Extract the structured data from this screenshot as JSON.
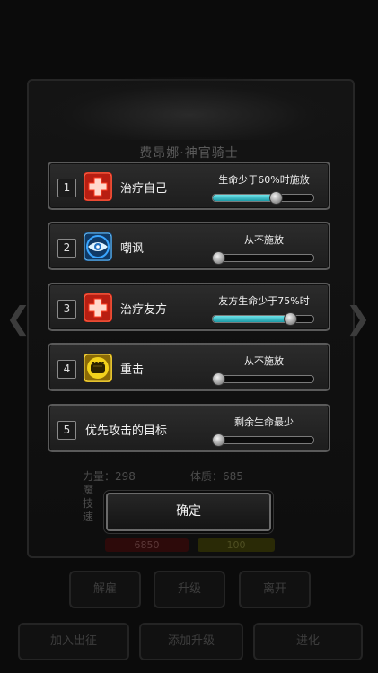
{
  "background": {
    "title": "费昂娜·神官骑士",
    "stats": [
      "力量：298",
      "体质：685",
      "魔",
      "技",
      "速"
    ],
    "hp_value": "6850",
    "gold_value": "100",
    "buttons": [
      "解雇",
      "升级",
      "离开",
      "加入出征",
      "添加升级",
      "进化"
    ]
  },
  "rows": [
    {
      "number": "1",
      "skill": "治疗自己",
      "condition": "生命少于60%时施放",
      "icon": "red-cross-heal-icon",
      "level": 0.6
    },
    {
      "number": "2",
      "skill": "嘲讽",
      "condition": "从不施放",
      "icon": "blue-eye-taunt-icon",
      "level": 0
    },
    {
      "number": "3",
      "skill": "治疗友方",
      "condition": "友方生命少于75%时",
      "icon": "red-cross-heal-icon",
      "level": 0.75
    },
    {
      "number": "4",
      "skill": "重击",
      "condition": "从不施放",
      "icon": "yellow-fist-smash-icon",
      "level": 0
    },
    {
      "number": "5",
      "skill": "优先攻击的目标",
      "condition": "剩余生命最少",
      "level": 0
    }
  ],
  "confirm_label": "确定",
  "colors": {
    "slider_fill": "#1fa5b0",
    "heal_icon": "#d92b1c",
    "taunt_icon": "#2a7fc0",
    "smash_icon": "#e0c71a"
  }
}
